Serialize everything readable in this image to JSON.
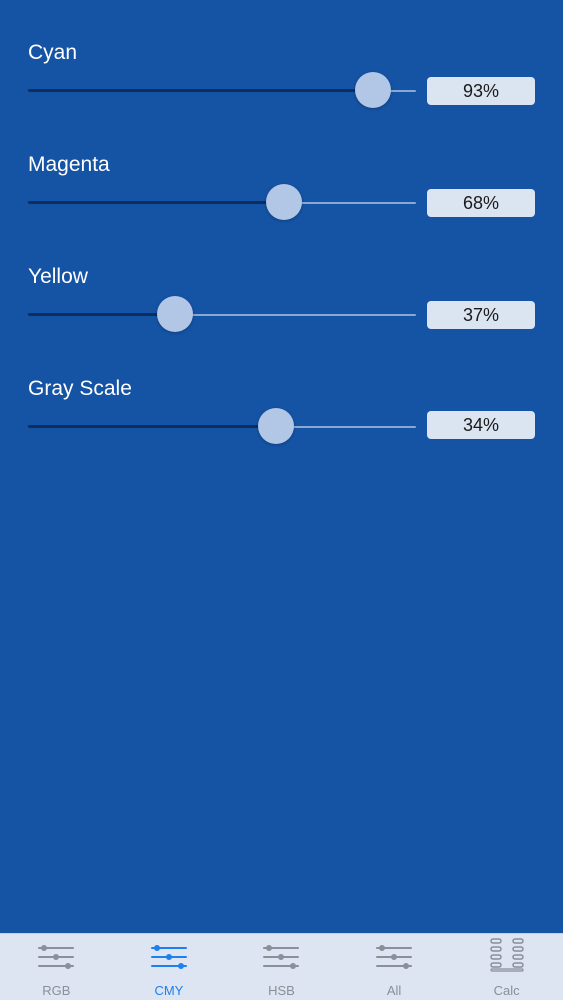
{
  "sliders": [
    {
      "label": "Cyan",
      "value_text": "93%",
      "level": 0.89
    },
    {
      "label": "Magenta",
      "value_text": "68%",
      "level": 0.66
    },
    {
      "label": "Yellow",
      "value_text": "37%",
      "level": 0.38
    },
    {
      "label": "Gray Scale",
      "value_text": "34%",
      "level": 0.64
    }
  ],
  "tabbar": {
    "tabs": [
      {
        "label": "RGB",
        "icon": "sliders-icon",
        "active": false
      },
      {
        "label": "CMY",
        "icon": "sliders-icon",
        "active": true
      },
      {
        "label": "HSB",
        "icon": "sliders-icon",
        "active": false
      },
      {
        "label": "All",
        "icon": "sliders-icon",
        "active": false
      },
      {
        "label": "Calc",
        "icon": "calculator-icon",
        "active": false
      }
    ]
  },
  "colors": {
    "background": "#1553a5",
    "tabbar_background": "#dce5f1",
    "active_tab": "#1e7ff0",
    "inactive_tab": "#8a8f99"
  }
}
